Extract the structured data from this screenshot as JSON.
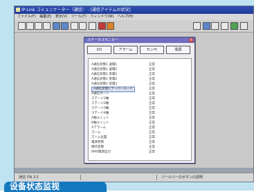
{
  "window": {
    "title": "IP-Link コミュニケーター（通信） - [通信アイテムの状況]",
    "menu": [
      "ファイル(F)",
      "編集(E)",
      "表示(V)",
      "ツール(T)",
      "ウィンドウ(W)",
      "ヘルプ(H)"
    ]
  },
  "dialog": {
    "title": "ステータスモニター",
    "close_label": "×",
    "tabs": [
      "I/O",
      "アラーム",
      "センサ",
      "電源"
    ],
    "rows": [
      {
        "name": "A通信状態1 送電1",
        "value": "正常"
      },
      {
        "name": "A通信状態1 送電2",
        "value": "正常"
      },
      {
        "name": "A通信状態1 受電1",
        "value": "正常"
      },
      {
        "name": "A通信状態1 受電2",
        "value": "正常"
      },
      {
        "name": "A通信状態1 受電3",
        "value": "正常"
      },
      {
        "name": "A通信状態1 テーパーモード",
        "value": "正常"
      },
      {
        "name": "A通信ポート",
        "value": "正常"
      },
      {
        "name": "ステージ1軸",
        "value": "正常"
      },
      {
        "name": "ステージ2軸",
        "value": "正常"
      },
      {
        "name": "ステージ3軸",
        "value": "正常"
      },
      {
        "name": "ステージ4軸",
        "value": "正常"
      },
      {
        "name": "A軸ユニット",
        "value": "正常"
      },
      {
        "name": "B軸ユニット",
        "value": "正常"
      },
      {
        "name": "Xアラーム",
        "value": "正常"
      },
      {
        "name": "ズーム",
        "value": "正常"
      },
      {
        "name": "ズーム位置",
        "value": "正常"
      },
      {
        "name": "電源状態",
        "value": "正常"
      },
      {
        "name": "輝点状態",
        "value": "正常"
      },
      {
        "name": "RMS電源出力",
        "value": "正常"
      }
    ]
  },
  "statusbar": {
    "left": "通信 ON 1/1",
    "right": "ツールバーのボタンの説明"
  },
  "caption": "设备状态监视"
}
